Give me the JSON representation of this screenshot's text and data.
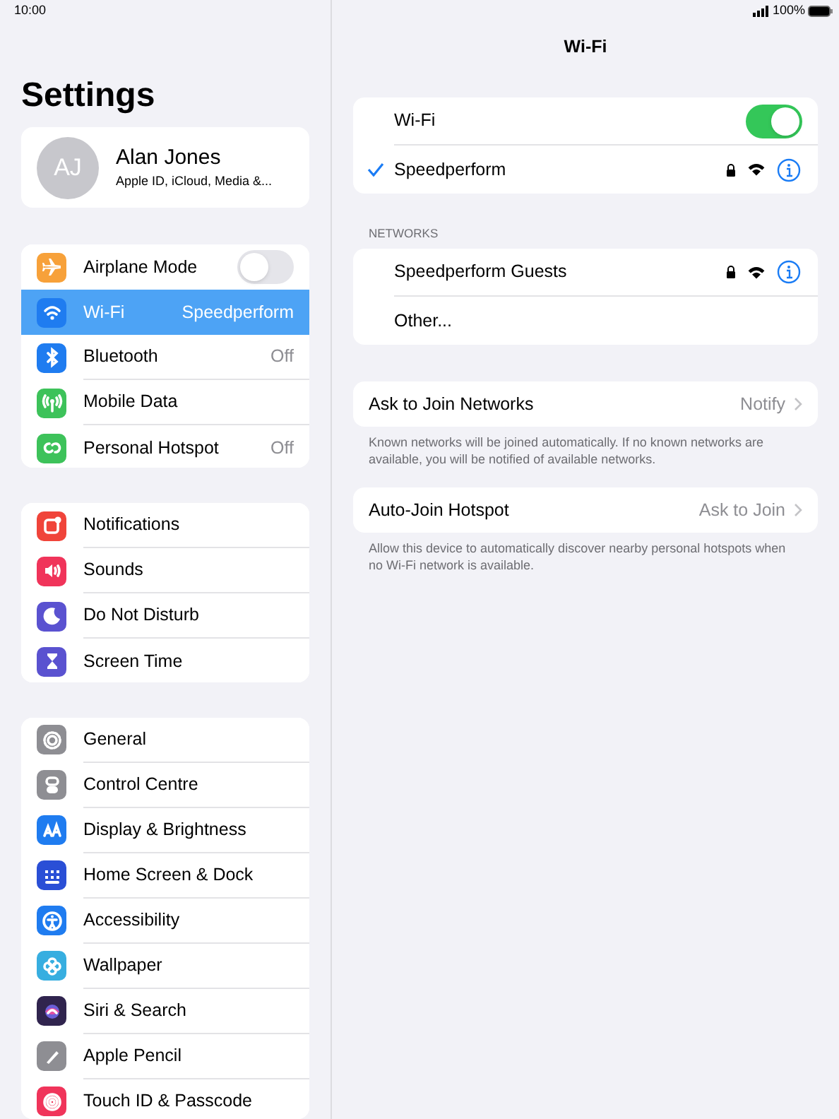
{
  "status_bar": {
    "time": "10:00",
    "battery": "100%"
  },
  "sidebar": {
    "title": "Settings",
    "profile": {
      "initials": "AJ",
      "name": "Alan Jones",
      "subtitle": "Apple ID, iCloud, Media &..."
    },
    "groups": [
      {
        "items": [
          {
            "label": "Airplane Mode",
            "kind": "toggle",
            "on": false,
            "selected": false,
            "color": "#f7a13a"
          },
          {
            "label": "Wi-Fi",
            "value": "Speedperform",
            "kind": "link",
            "selected": true,
            "color": "#1f7cf0"
          },
          {
            "label": "Bluetooth",
            "value": "Off",
            "kind": "link",
            "selected": false,
            "color": "#1f7cf0"
          },
          {
            "label": "Mobile Data",
            "kind": "link",
            "selected": false,
            "color": "#3dc25a"
          },
          {
            "label": "Personal Hotspot",
            "value": "Off",
            "kind": "link",
            "selected": false,
            "color": "#3dc25a"
          }
        ]
      },
      {
        "items": [
          {
            "label": "Notifications",
            "kind": "link",
            "selected": false,
            "color": "#f0443a"
          },
          {
            "label": "Sounds",
            "kind": "link",
            "selected": false,
            "color": "#f0345a"
          },
          {
            "label": "Do Not Disturb",
            "kind": "link",
            "selected": false,
            "color": "#5a52d0"
          },
          {
            "label": "Screen Time",
            "kind": "link",
            "selected": false,
            "color": "#5a52d0"
          }
        ]
      },
      {
        "items": [
          {
            "label": "General",
            "kind": "link",
            "selected": false,
            "color": "#8e8e93"
          },
          {
            "label": "Control Centre",
            "kind": "link",
            "selected": false,
            "color": "#8e8e93"
          },
          {
            "label": "Display & Brightness",
            "kind": "link",
            "selected": false,
            "color": "#1f7cf0"
          },
          {
            "label": "Home Screen & Dock",
            "kind": "link",
            "selected": false,
            "color": "#2a4fd6"
          },
          {
            "label": "Accessibility",
            "kind": "link",
            "selected": false,
            "color": "#1f7cf0"
          },
          {
            "label": "Wallpaper",
            "kind": "link",
            "selected": false,
            "color": "#37aee0"
          },
          {
            "label": "Siri & Search",
            "kind": "link",
            "selected": false,
            "color": "#30244e"
          },
          {
            "label": "Apple Pencil",
            "kind": "link",
            "selected": false,
            "color": "#8e8e93"
          },
          {
            "label": "Touch ID & Passcode",
            "kind": "link",
            "selected": false,
            "color": "#f0345a"
          }
        ]
      }
    ]
  },
  "detail": {
    "title": "Wi-Fi",
    "wifi": {
      "label": "Wi-Fi",
      "on": true
    },
    "current": [
      {
        "name": "Speedperform",
        "connected": true,
        "secured": true
      }
    ],
    "networks_header": "NETWORKS",
    "networks": [
      {
        "name": "Speedperform Guests",
        "connected": false,
        "secured": true
      }
    ],
    "other": "Other...",
    "options": [
      {
        "label": "Ask to Join Networks",
        "value": "Notify",
        "footer": "Known networks will be joined automatically. If no known networks are available, you will be notified of available networks."
      },
      {
        "label": "Auto-Join Hotspot",
        "value": "Ask to Join",
        "footer": "Allow this device to automatically discover nearby personal hotspots when no Wi-Fi network is available."
      }
    ]
  }
}
